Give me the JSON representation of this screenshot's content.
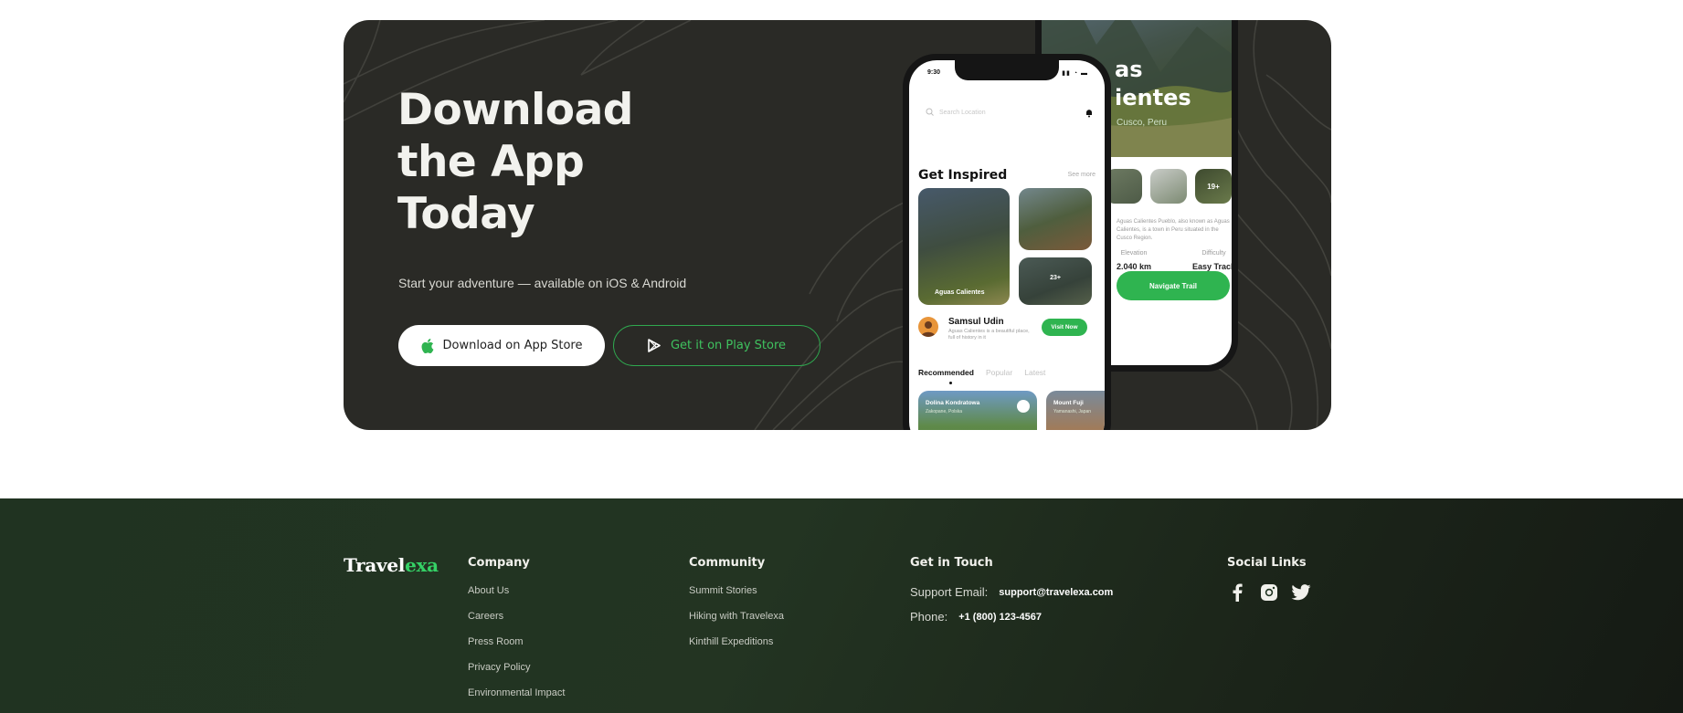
{
  "banner": {
    "title_lines": [
      "Download",
      "the App",
      "Today"
    ],
    "subtitle": "Start your adventure — available on iOS & Android",
    "app_store_label": "Download on App Store",
    "play_store_label": "Get it on Play Store"
  },
  "phone_front": {
    "time": "9:30",
    "search_placeholder": "Search Location",
    "section_title": "Get Inspired",
    "see_more": "See more",
    "card_main_label": "Aguas Calientes",
    "card_more_label": "23+",
    "user_name": "Samsul Udin",
    "user_desc": "Aguas Calientes is a beautiful place, full of history in it",
    "visit_label": "Visit Now",
    "tabs": [
      "Recommended",
      "Popular",
      "Latest"
    ],
    "rec_cards": [
      {
        "title": "Dolina Kondratowa",
        "location": "Zakopane, Polska"
      },
      {
        "title": "Mount Fuji",
        "location": "Yamanashi, Japan"
      }
    ]
  },
  "phone_back": {
    "title_lines": [
      "as",
      "ientes"
    ],
    "subtitle": "Cusco, Peru",
    "thumb_more": "19+",
    "description": "Aguas Calientes Pueblo, also known as Aguas Calientes, is a town in Peru situated in the Cusco Region.",
    "stats": [
      {
        "key": "Elevation",
        "value": "2.040 km"
      },
      {
        "key": "Difficulty",
        "value": "Easy Track"
      }
    ],
    "navigate_label": "Navigate Trail"
  },
  "footer": {
    "logo_main": "Travel",
    "logo_accent": "exa",
    "company": {
      "heading": "Company",
      "links": [
        "About Us",
        "Careers",
        "Press Room",
        "Privacy Policy",
        "Environmental Impact"
      ]
    },
    "community": {
      "heading": "Community",
      "links": [
        "Summit Stories",
        "Hiking with Travelexa",
        "Kinthill Expeditions"
      ]
    },
    "contact": {
      "heading": "Get in Touch",
      "email_label": "Support Email:",
      "email": "support@travelexa.com",
      "phone_label": "Phone:",
      "phone": "+1 (800) 123-4567"
    },
    "social": {
      "heading": "Social Links",
      "icons": [
        "facebook-icon",
        "instagram-icon",
        "twitter-icon"
      ]
    }
  },
  "colors": {
    "banner_bg": "#2a2a26",
    "accent_green": "#2fb450",
    "footer_bg": "#203321"
  }
}
